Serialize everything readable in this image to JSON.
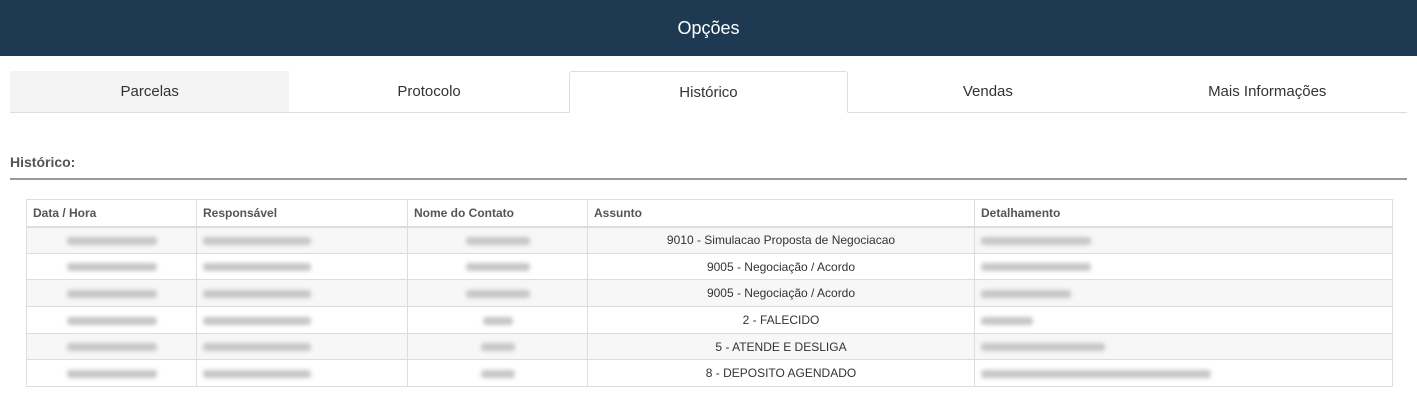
{
  "header": {
    "title": "Opções"
  },
  "tabs": [
    {
      "label": "Parcelas"
    },
    {
      "label": "Protocolo"
    },
    {
      "label": "Histórico"
    },
    {
      "label": "Vendas"
    },
    {
      "label": "Mais Informações"
    }
  ],
  "active_tab": "Histórico",
  "section": {
    "title": "Histórico:"
  },
  "table": {
    "columns": [
      "Data / Hora",
      "Responsável",
      "Nome do Contato",
      "Assunto",
      "Detalhamento"
    ],
    "rows": [
      {
        "assunto": "9010 - Simulacao Proposta de Negociacao"
      },
      {
        "assunto": "9005 - Negociação / Acordo"
      },
      {
        "assunto": "9005 - Negociação / Acordo"
      },
      {
        "assunto": "2 - FALECIDO"
      },
      {
        "assunto": "5 - ATENDE E DESLIGA"
      },
      {
        "assunto": "8 - DEPOSITO AGENDADO"
      }
    ]
  },
  "colors": {
    "header_bg": "#1d3a52",
    "header_text": "#ffffff",
    "stripe": "#f7f7f7",
    "border": "#dddddd"
  }
}
